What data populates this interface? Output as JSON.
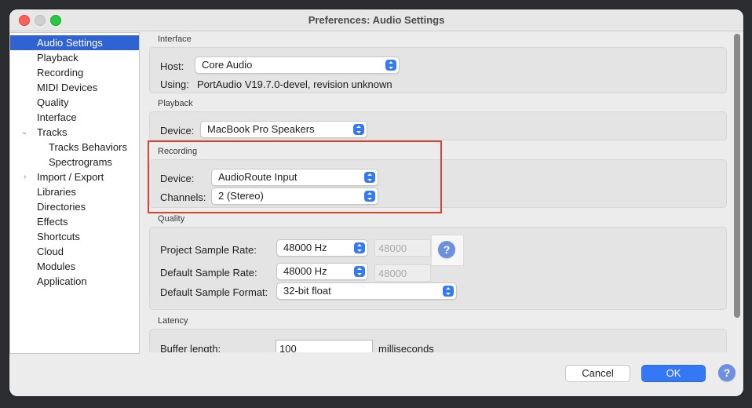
{
  "window": {
    "title": "Preferences: Audio Settings"
  },
  "sidebar": {
    "items": [
      {
        "label": "Audio Settings",
        "selected": true
      },
      {
        "label": "Playback"
      },
      {
        "label": "Recording"
      },
      {
        "label": "MIDI Devices"
      },
      {
        "label": "Quality"
      },
      {
        "label": "Interface"
      },
      {
        "label": "Tracks",
        "expanded": true
      },
      {
        "label": "Tracks Behaviors"
      },
      {
        "label": "Spectrograms"
      },
      {
        "label": "Import / Export",
        "expanded": false
      },
      {
        "label": "Libraries"
      },
      {
        "label": "Directories"
      },
      {
        "label": "Effects"
      },
      {
        "label": "Shortcuts"
      },
      {
        "label": "Cloud"
      },
      {
        "label": "Modules"
      },
      {
        "label": "Application"
      }
    ]
  },
  "interface": {
    "section_label": "Interface",
    "host_label": "Host:",
    "host_value": "Core Audio",
    "using_label": "Using:",
    "using_value": "PortAudio V19.7.0-devel, revision unknown"
  },
  "playback": {
    "section_label": "Playback",
    "device_label": "Device:",
    "device_value": "MacBook Pro Speakers"
  },
  "recording": {
    "section_label": "Recording",
    "device_label": "Device:",
    "device_value": "AudioRoute Input",
    "channels_label": "Channels:",
    "channels_value": "2 (Stereo)"
  },
  "quality": {
    "section_label": "Quality",
    "project_rate_label": "Project Sample Rate:",
    "project_rate_value": "48000 Hz",
    "project_rate_field": "48000",
    "default_rate_label": "Default Sample Rate:",
    "default_rate_value": "48000 Hz",
    "default_rate_field": "48000",
    "format_label": "Default Sample Format:",
    "format_value": "32-bit float",
    "help_glyph": "?"
  },
  "latency": {
    "section_label": "Latency",
    "buffer_label": "Buffer length:",
    "buffer_value": "100",
    "buffer_unit": "milliseconds"
  },
  "footer": {
    "cancel_label": "Cancel",
    "ok_label": "OK",
    "help_glyph": "?"
  },
  "colors": {
    "accent": "#3578f6",
    "selection": "#2f62d2",
    "highlight": "#d9432e"
  }
}
